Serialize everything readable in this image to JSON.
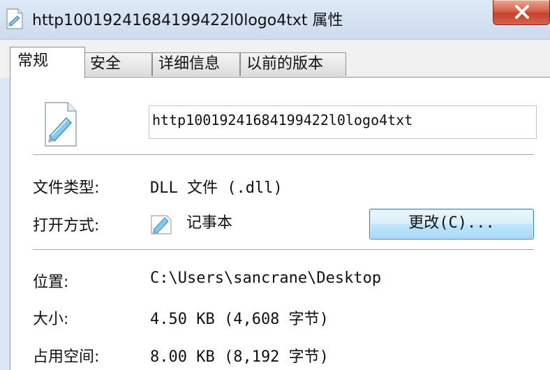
{
  "window": {
    "title": "http10019241684199422l0logo4txt 属性",
    "close_icon": "close-icon"
  },
  "tabs": [
    {
      "label": "常规",
      "active": true
    },
    {
      "label": "安全",
      "active": false
    },
    {
      "label": "详细信息",
      "active": false
    },
    {
      "label": "以前的版本",
      "active": false
    }
  ],
  "general": {
    "file_name": "http10019241684199422l0logo4txt",
    "type_label": "文件类型:",
    "type_value": "DLL 文件 (.dll)",
    "open_with_label": "打开方式:",
    "open_with_app": "记事本",
    "change_button": "更改(C)...",
    "location_label": "位置:",
    "location_value": "C:\\Users\\sancrane\\Desktop",
    "size_label": "大小:",
    "size_value": "4.50 KB (4,608 字节)",
    "disk_size_label": "占用空间:",
    "disk_size_value": "8.00 KB (8,192 字节)"
  }
}
